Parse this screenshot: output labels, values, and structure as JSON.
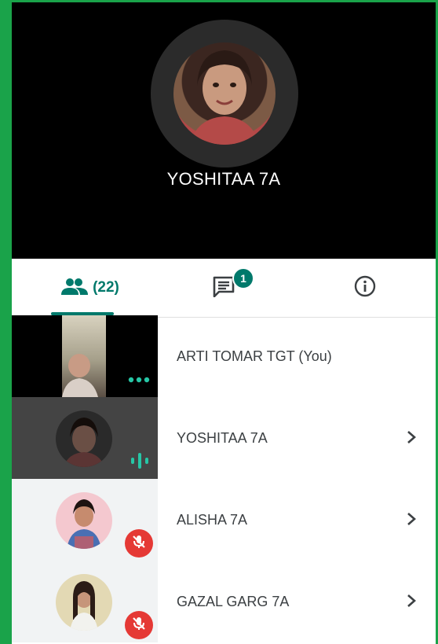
{
  "stage": {
    "speaker_name": "YOSHITAA 7A"
  },
  "tabs": {
    "people_count": "(22)",
    "chat_badge": "1"
  },
  "participants": [
    {
      "name": "ARTI TOMAR TGT (You)",
      "status": "more-dots-icon"
    },
    {
      "name": "YOSHITAA 7A",
      "status": "speaking-icon"
    },
    {
      "name": "ALISHA 7A",
      "status": "mic-off-icon"
    },
    {
      "name": "GAZAL GARG 7A",
      "status": "mic-off-icon"
    }
  ],
  "colors": {
    "accent": "#00796b",
    "border": "#1aa34a",
    "muted": "#e53935",
    "speaking": "#26c6a6"
  }
}
